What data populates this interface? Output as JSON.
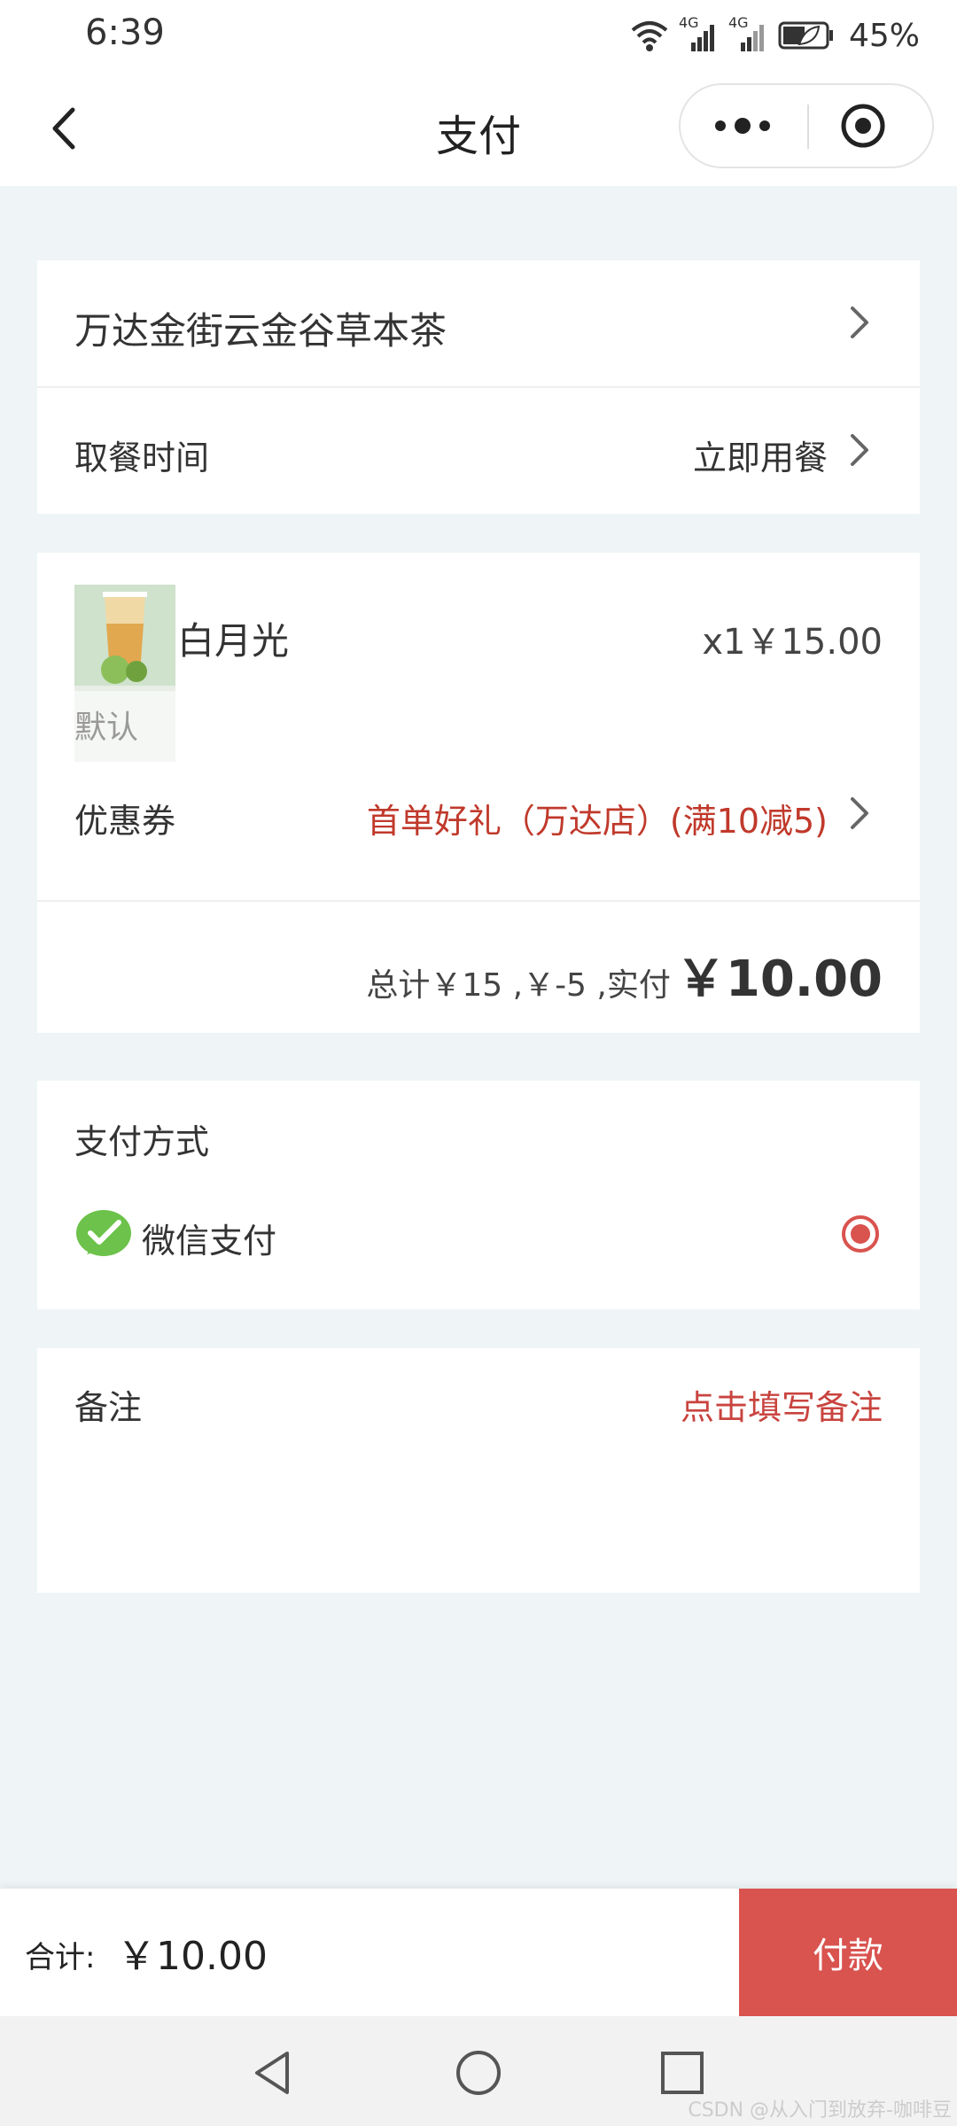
{
  "status_bar": {
    "time": "6:39",
    "network_1": "4G",
    "network_2": "4G",
    "battery": "45%"
  },
  "nav": {
    "title": "支付"
  },
  "store": {
    "name": "万达金街云金谷草本茶"
  },
  "pickup": {
    "label": "取餐时间",
    "value": "立即用餐"
  },
  "item": {
    "name": "白月光",
    "spec": "默认",
    "qty_price": "x1￥15.00"
  },
  "coupon": {
    "label": "优惠券",
    "value": "首单好礼（万达店）(满10减5)"
  },
  "totals": {
    "summary": "总计￥15 ,￥-5 ,实付",
    "amount": "￥10.00"
  },
  "payment": {
    "section_title": "支付方式",
    "method": "微信支付"
  },
  "remark": {
    "label": "备注",
    "action": "点击填写备注"
  },
  "bottom": {
    "total_label": "合计:",
    "total_value": "￥10.00",
    "pay_button": "付款"
  },
  "watermark": "CSDN @从入门到放弃-咖啡豆",
  "colors": {
    "accent_red": "#d9534f",
    "coupon_red": "#c0392b",
    "wechat_green": "#6cc24a",
    "page_bg": "#eff5f6"
  }
}
